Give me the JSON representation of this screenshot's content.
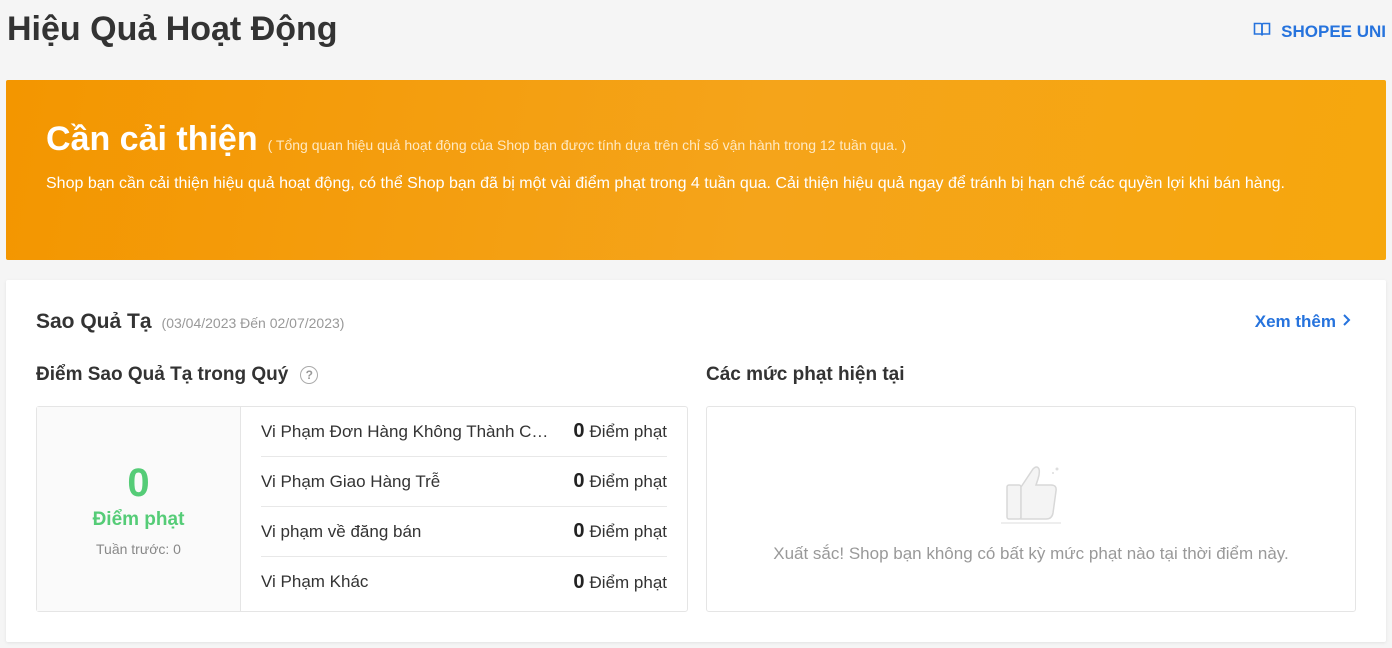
{
  "header": {
    "title": "Hiệu Quả Hoạt Động",
    "uni_link": "SHOPEE UNI",
    "uni_icon": "book-icon"
  },
  "banner": {
    "status": "Cần cải thiện",
    "note": "( Tổng quan hiệu quả hoạt động của Shop bạn được tính dựa trên chỉ số vận hành trong 12 tuần qua. )",
    "description": "Shop bạn cần cải thiện hiệu quả hoạt động, có thể Shop bạn đã bị một vài điểm phạt trong 4 tuần qua. Cải thiện hiệu quả ngay để tránh bị hạn chế các quyền lợi khi bán hàng.",
    "color_start": "#f39600",
    "color_end": "#f6a70d"
  },
  "penalty_card": {
    "title": "Sao Quả Tạ",
    "date_range": "(03/04/2023 Đến 02/07/2023)",
    "see_more": "Xem thêm",
    "score_section_title": "Điểm Sao Quả Tạ trong Quý",
    "score": "0",
    "score_unit": "Điểm phạt",
    "last_week": "Tuần trước: 0",
    "rows": [
      {
        "label": "Vi Phạm Đơn Hàng Không Thành Công",
        "value": "0",
        "unit": "Điểm phạt"
      },
      {
        "label": "Vi Phạm Giao Hàng Trễ",
        "value": "0",
        "unit": "Điểm phạt"
      },
      {
        "label": "Vi phạm về đăng bán",
        "value": "0",
        "unit": "Điểm phạt"
      },
      {
        "label": "Vi Phạm Khác",
        "value": "0",
        "unit": "Điểm phạt"
      }
    ],
    "current_section_title": "Các mức phạt hiện tại",
    "empty_message": "Xuất sắc! Shop bạn không có bất kỳ mức phạt nào tại thời điểm này.",
    "success_color": "#55cc77",
    "link_color": "#2673dd"
  }
}
